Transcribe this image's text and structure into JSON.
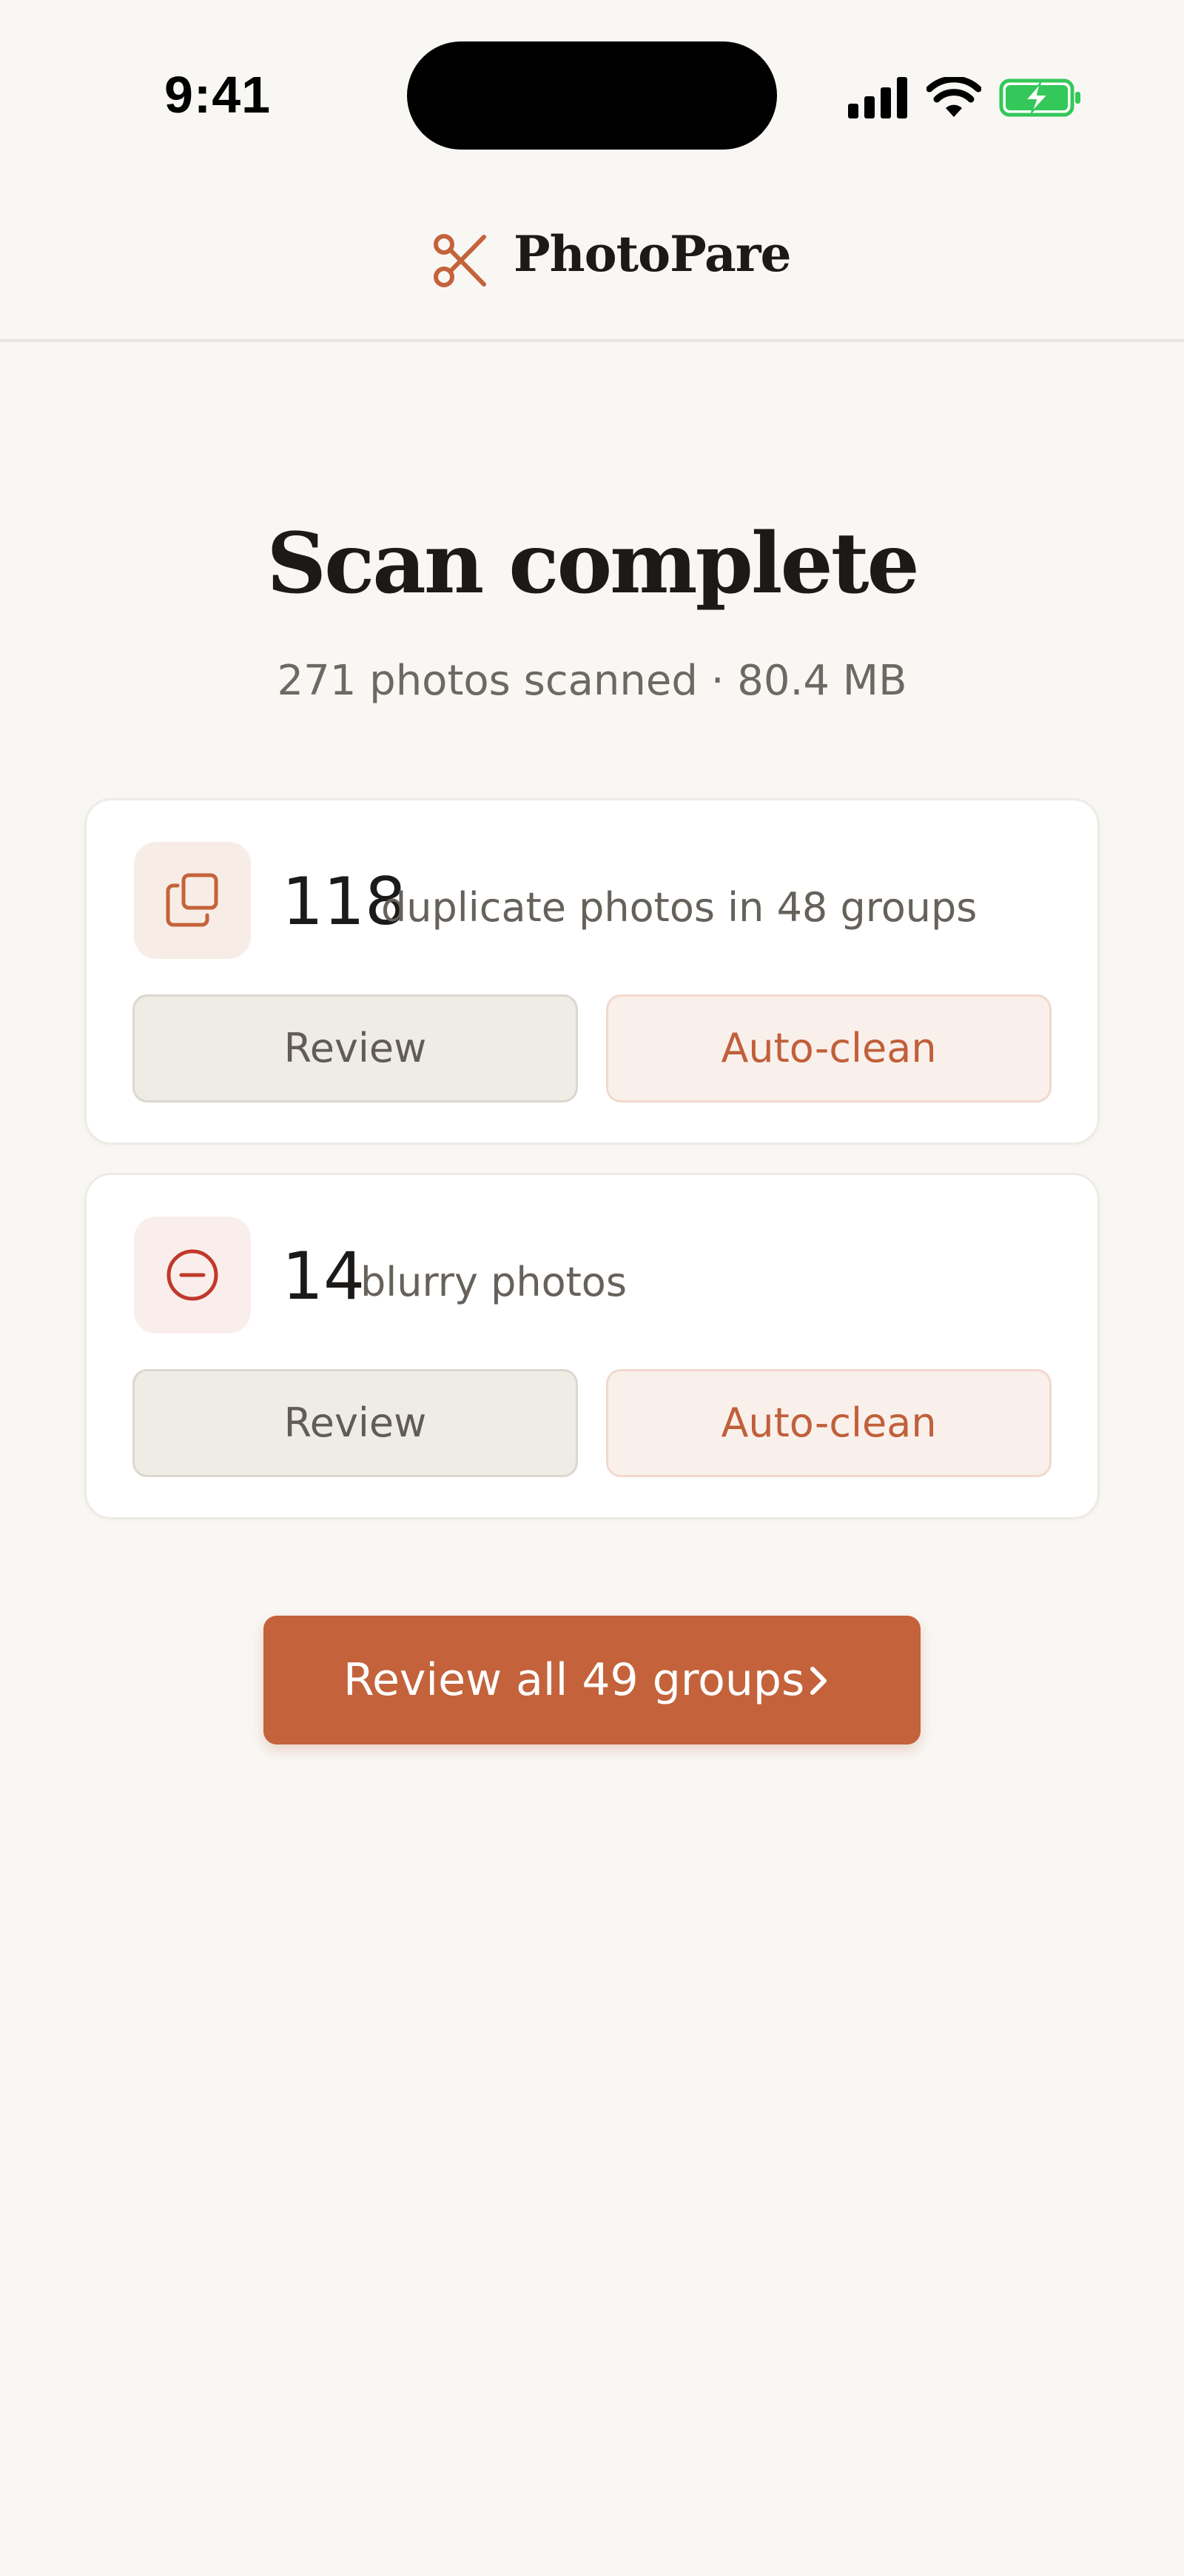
{
  "status_bar": {
    "time": "9:41",
    "icons": [
      "signal-icon",
      "wifi-icon",
      "battery-charging-icon"
    ],
    "battery_color": "#34c759"
  },
  "header": {
    "brand_icon": "scissors-icon",
    "brand_name": "PhotoPare"
  },
  "scan": {
    "title": "Scan complete",
    "subtitle": "271 photos scanned · 80.4 MB"
  },
  "cards": [
    {
      "icon": "duplicate-icon",
      "count": "118",
      "description": "duplicate photos in 48 groups",
      "review_label": "Review",
      "autoclean_label": "Auto-clean"
    },
    {
      "icon": "blur-minus-circle-icon",
      "count": "14",
      "description": "blurry photos",
      "review_label": "Review",
      "autoclean_label": "Auto-clean"
    }
  ],
  "cta": {
    "label": "Review all 49 groups",
    "icon": "chevron-right-icon"
  },
  "colors": {
    "accent": "#c4633b",
    "background": "#f9f7f4",
    "blur_icon": "#c0392b"
  }
}
